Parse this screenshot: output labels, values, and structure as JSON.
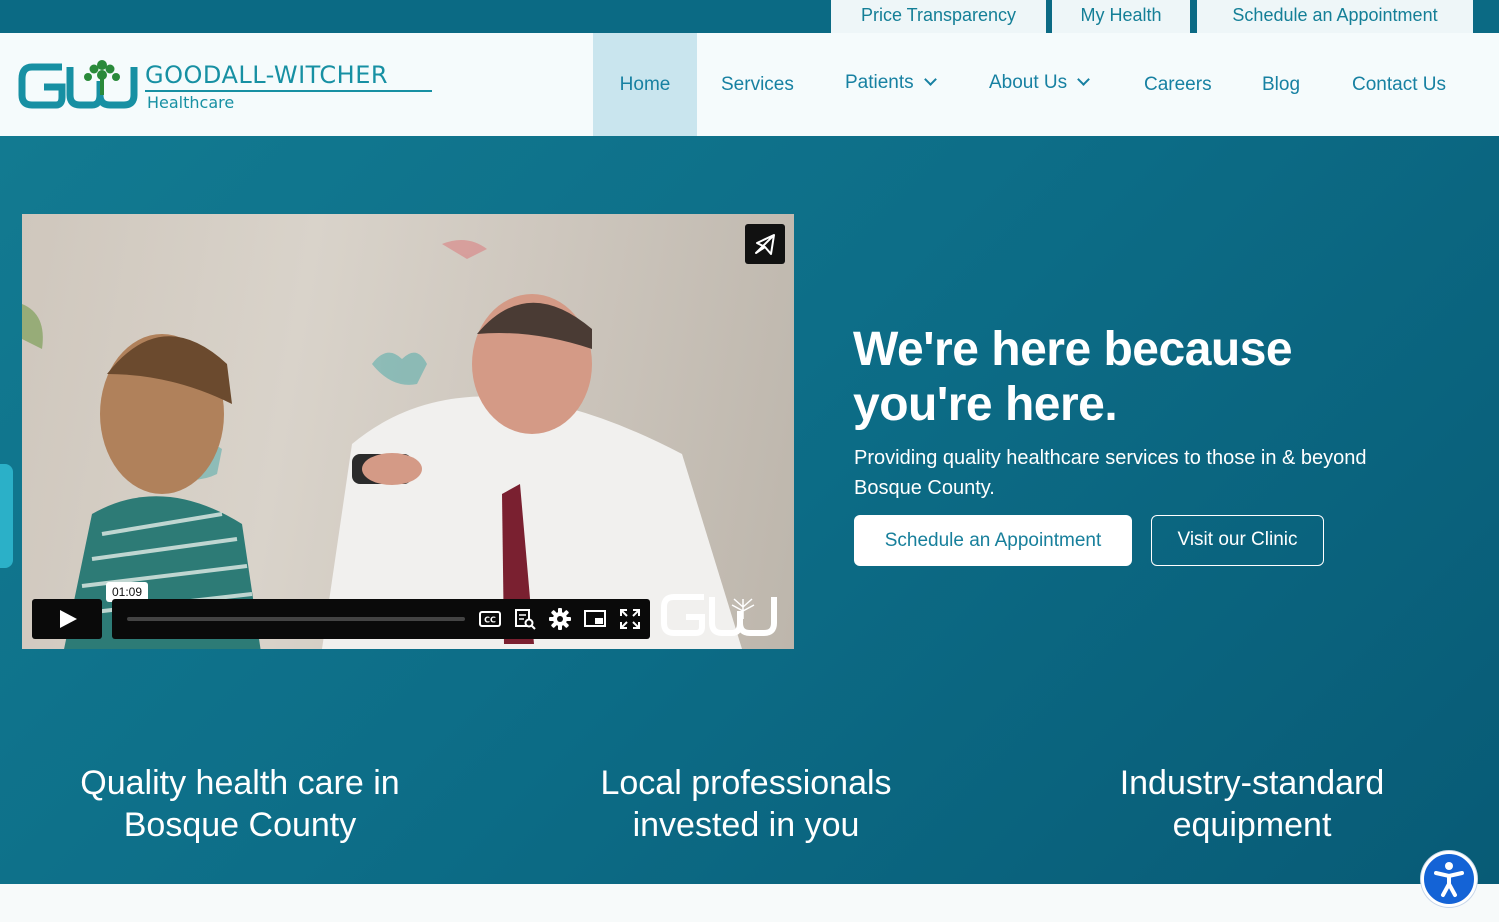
{
  "utility_nav": {
    "price_transparency": "Price Transparency",
    "my_health": "My Health",
    "schedule": "Schedule an Appointment"
  },
  "logo": {
    "name": "GOODALL-WITCHER",
    "sub": "Healthcare"
  },
  "nav": {
    "home": "Home",
    "services": "Services",
    "patients": "Patients",
    "about": "About Us",
    "careers": "Careers",
    "blog": "Blog",
    "contact": "Contact Us"
  },
  "video": {
    "timecode": "01:09"
  },
  "hero": {
    "title": "We're here because you're here.",
    "subtitle": "Providing quality healthcare services to those in & beyond Bosque County.",
    "cta_primary": "Schedule an Appointment",
    "cta_secondary": "Visit our Clinic"
  },
  "features": [
    {
      "text": "Quality health care in Bosque County"
    },
    {
      "text": "Local professionals invested in you"
    },
    {
      "text": "Industry-standard equipment"
    }
  ],
  "colors": {
    "brand_teal": "#1790a3",
    "hero_bg": "#0d6e88",
    "accessibility_blue": "#1463d6"
  }
}
